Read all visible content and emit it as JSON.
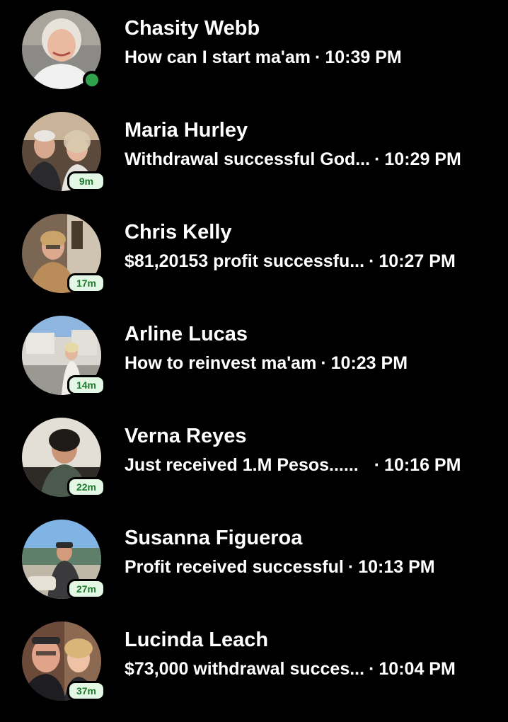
{
  "chats": [
    {
      "name": "Chasity Webb",
      "preview": "How can I start ma'am",
      "time": "10:39 PM",
      "badge": "",
      "online": true,
      "avatar_icon": "profile-photo-woman-white-hair"
    },
    {
      "name": "Maria Hurley",
      "preview": "Withdrawal successful God...",
      "time": "10:29 PM",
      "badge": "9m",
      "online": false,
      "avatar_icon": "profile-photo-couple"
    },
    {
      "name": "Chris Kelly",
      "preview": "$81,20153 profit successfu...",
      "time": "10:27 PM",
      "badge": "17m",
      "online": false,
      "avatar_icon": "profile-photo-woman-indoors"
    },
    {
      "name": "Arline Lucas",
      "preview": "How to reinvest ma'am",
      "time": "10:23 PM",
      "badge": "14m",
      "online": false,
      "avatar_icon": "profile-photo-woman-outdoors"
    },
    {
      "name": "Verna Reyes",
      "preview": "Just received 1.M Pesos......",
      "time": "10:16 PM",
      "badge": "22m",
      "online": false,
      "avatar_icon": "profile-photo-woman-dark-hair"
    },
    {
      "name": "Susanna Figueroa",
      "preview": "Profit received successful",
      "time": "10:13 PM",
      "badge": "27m",
      "online": false,
      "avatar_icon": "profile-photo-man-beach"
    },
    {
      "name": "Lucinda Leach",
      "preview": "$73,000 withdrawal succes...",
      "time": "10:04 PM",
      "badge": "37m",
      "online": false,
      "avatar_icon": "profile-photo-couple-selfie"
    }
  ],
  "separator": "·",
  "colors": {
    "background": "#000000",
    "text": "#ffffff",
    "online_green": "#31a24c",
    "badge_bg": "#e4f6e4",
    "badge_text": "#1a7a2a"
  }
}
